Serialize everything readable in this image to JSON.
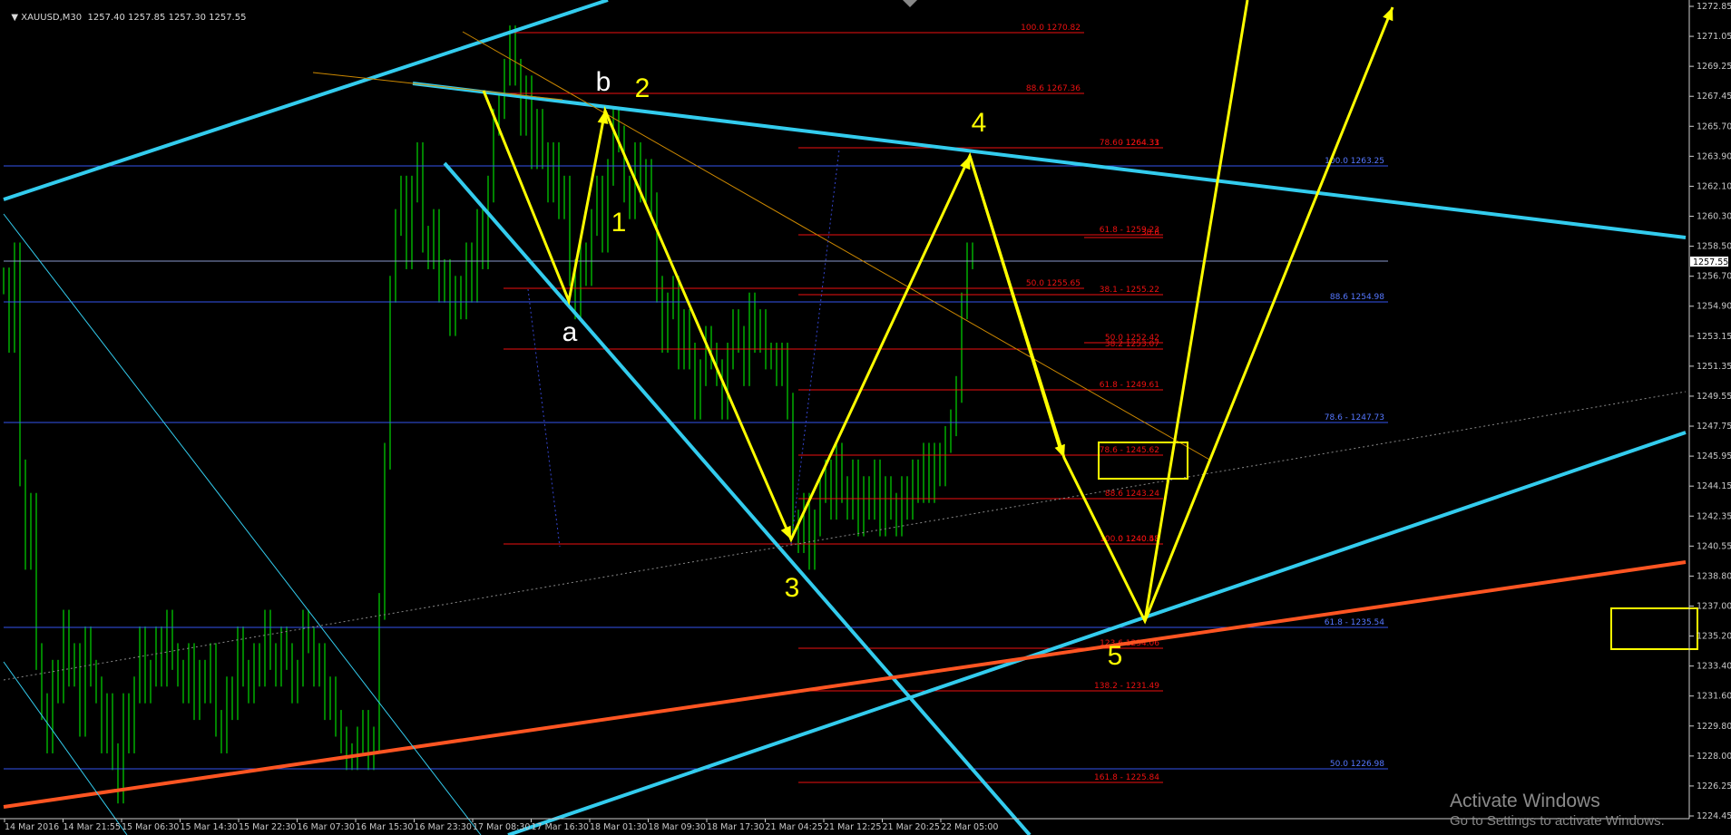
{
  "header": {
    "symbol": "XAUUSD,M30",
    "ohlc": "1257.40 1257.85 1257.30 1257.55",
    "price_tag": "1257.55"
  },
  "watermark": {
    "title": "Activate Windows",
    "subtitle": "Go to Settings to activate Windows."
  },
  "colors": {
    "background": "#000000",
    "candles": "#00c800",
    "wave": "#ffff00",
    "trendline": "#33ccee",
    "support": "#ff5522",
    "fib_red": "#ee1111",
    "fib_blue": "#3355ee",
    "grid_text": "#c8c8c8"
  },
  "chart_data": {
    "type": "line",
    "ylim": [
      1224.45,
      1273.0
    ],
    "y_ticks": [
      "1272.85",
      "1271.05",
      "1269.25",
      "1267.45",
      "1265.70",
      "1263.90",
      "1262.10",
      "1260.30",
      "1258.50",
      "1256.70",
      "1254.90",
      "1253.15",
      "1251.35",
      "1249.55",
      "1247.75",
      "1245.95",
      "1244.15",
      "1242.35",
      "1240.55",
      "1238.80",
      "1237.00",
      "1235.20",
      "1233.40",
      "1231.60",
      "1229.80",
      "1228.00",
      "1226.25",
      "1224.45"
    ],
    "x_ticks": [
      "14 Mar 2016",
      "14 Mar 21:55",
      "15 Mar 06:30",
      "15 Mar 14:30",
      "15 Mar 22:30",
      "16 Mar 07:30",
      "16 Mar 15:30",
      "16 Mar 23:30",
      "17 Mar 08:30",
      "17 Mar 16:30",
      "18 Mar 01:30",
      "18 Mar 09:30",
      "18 Mar 17:30",
      "21 Mar 04:25",
      "21 Mar 12:25",
      "21 Mar 20:25",
      "22 Mar 05:00"
    ],
    "series": [
      {
        "values": [
          1256.5,
          1253,
          1258,
          1245,
          1240,
          1243,
          1234,
          1231,
          1229,
          1233,
          1232,
          1236,
          1233,
          1234,
          1230,
          1235,
          1233,
          1232,
          1229,
          1231,
          1228,
          1226,
          1231,
          1229,
          1232,
          1235,
          1232,
          1233,
          1235,
          1233,
          1236,
          1234,
          1233,
          1232,
          1234,
          1231,
          1233,
          1232,
          1234,
          1230,
          1229,
          1232,
          1231,
          1235,
          1233,
          1232,
          1234,
          1233,
          1236,
          1234,
          1233,
          1235,
          1234,
          1232,
          1233,
          1236,
          1235,
          1233,
          1234,
          1231,
          1232,
          1230,
          1229,
          1228,
          1228,
          1229,
          1230,
          1228,
          1229,
          1237,
          1246,
          1256,
          1260,
          1262,
          1258,
          1262,
          1264,
          1259,
          1258,
          1260,
          1256,
          1257,
          1254,
          1256,
          1255,
          1258,
          1256,
          1260,
          1258,
          1262,
          1266,
          1267,
          1269,
          1271,
          1269,
          1266,
          1268,
          1264,
          1266,
          1264,
          1262,
          1264,
          1261,
          1262,
          1257,
          1255,
          1258,
          1257,
          1260,
          1262,
          1259,
          1263,
          1266,
          1265,
          1262,
          1261,
          1264,
          1262,
          1263,
          1261,
          1256,
          1253,
          1255,
          1256,
          1252,
          1254,
          1252,
          1249,
          1251,
          1253,
          1252,
          1251,
          1249,
          1252,
          1254,
          1253,
          1251,
          1255,
          1253,
          1254,
          1252,
          1252,
          1251,
          1252,
          1249,
          1242,
          1241,
          1243,
          1240,
          1242,
          1244,
          1245,
          1243,
          1246,
          1244,
          1243,
          1245,
          1242,
          1244,
          1243,
          1245,
          1242,
          1244,
          1243,
          1242,
          1244,
          1243,
          1245,
          1244,
          1246,
          1244,
          1246,
          1245,
          1247,
          1248,
          1250,
          1255,
          1258,
          1258
        ]
      }
    ],
    "wave_labels": [
      "b",
      "2",
      "1",
      "a",
      "4",
      "3",
      "5"
    ],
    "fib_levels_red": [
      {
        "label": "100.0 1270.82"
      },
      {
        "label": "88.6 1267.36"
      },
      {
        "label": "78.6 - 1264.33"
      },
      {
        "label": "0 1264.31"
      },
      {
        "label": "61.8 - 1259.23"
      },
      {
        "label": "38.6"
      },
      {
        "label": "50.0 1255.65"
      },
      {
        "label": "38.1 - 1255.22"
      },
      {
        "label": "38.2 1253.07"
      },
      {
        "label": "50.0 1252.42"
      },
      {
        "label": "61.8 - 1249.61"
      },
      {
        "label": "78.6 - 1245.62"
      },
      {
        "label": "88.6 1243.24"
      },
      {
        "label": "0 1240.48"
      },
      {
        "label": "100.0 1240.53"
      },
      {
        "label": "123.6 1234.06"
      },
      {
        "label": "138.2 - 1231.49"
      },
      {
        "label": "161.8 - 1225.84"
      }
    ],
    "fib_levels_blue": [
      {
        "label": "100.0 1263.25"
      },
      {
        "label": "88.6 1254.98"
      },
      {
        "label": "78.6 - 1247.73"
      },
      {
        "label": "61.8 - 1235.54"
      },
      {
        "label": "50.0 1226.98"
      }
    ]
  }
}
